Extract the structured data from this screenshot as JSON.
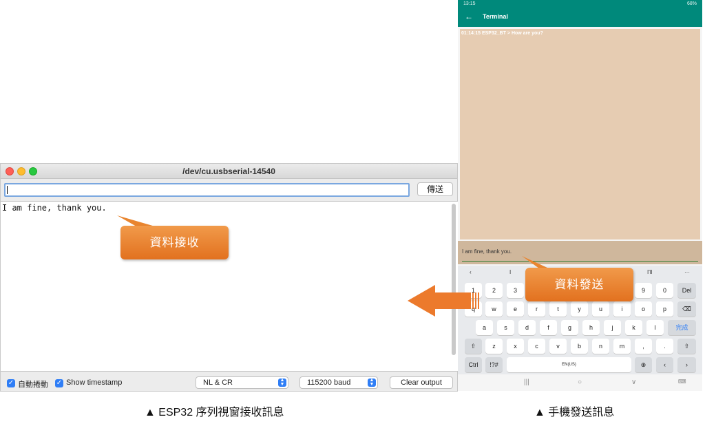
{
  "serial_monitor": {
    "window_title": "/dev/cu.usbserial-14540",
    "send_input_value": "",
    "send_button_label": "傳送",
    "output_lines": [
      "I am fine, thank you."
    ],
    "autoscroll_label": "自動捲動",
    "autoscroll_checked": true,
    "timestamp_label": "Show timestamp",
    "timestamp_checked": true,
    "line_ending": "NL & CR",
    "baud_rate": "115200 baud",
    "clear_button_label": "Clear output"
  },
  "phone": {
    "status_time": "13:15",
    "status_right": "68%",
    "back_icon": "arrow-left-icon",
    "appbar_title": "Terminal",
    "terminal_message": "01:14:15 ESP32_BT > How are you?",
    "input_text": "I am fine, thank you.",
    "suggestions": [
      "I",
      "I'll"
    ],
    "keyboard": {
      "row_numbers": [
        "1",
        "2",
        "3",
        "9",
        "0"
      ],
      "del_label": "Del",
      "row_q": [
        "q",
        "w",
        "e",
        "r",
        "t",
        "y",
        "u",
        "i",
        "o",
        "p"
      ],
      "row_a": [
        "a",
        "s",
        "d",
        "f",
        "g",
        "h",
        "j",
        "k",
        "l"
      ],
      "done_label": "完成",
      "row_z": [
        "z",
        "x",
        "c",
        "v",
        "b",
        "n",
        "m",
        ",",
        "."
      ],
      "ctrl_label": "Ctrl",
      "sym_label": "!?#",
      "space_label": "EN(US)"
    }
  },
  "callouts": {
    "receive": "資料接收",
    "send": "資料發送"
  },
  "colors": {
    "teal": "#00897b",
    "terminal_bg": "#e6ccb2",
    "callout_orange": "#e97f2c",
    "mac_accent": "#2f7ef6"
  },
  "captions": {
    "left": "▲  ESP32 序列視窗接收訊息",
    "right": "▲  手機發送訊息"
  }
}
